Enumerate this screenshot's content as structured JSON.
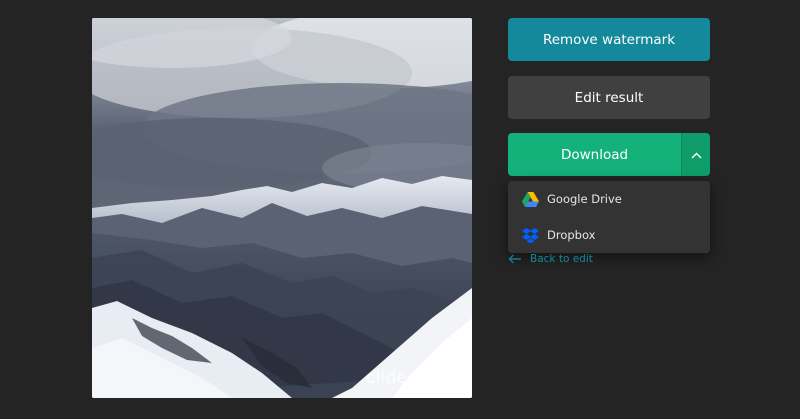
{
  "preview": {
    "watermark_text": "clideo.com"
  },
  "actions": {
    "remove_watermark_label": "Remove watermark",
    "edit_result_label": "Edit result",
    "download_label": "Download",
    "download_toggle_icon": "chevron-up-icon"
  },
  "download_menu": {
    "items": [
      {
        "label": "Google Drive",
        "icon": "google-drive-icon"
      },
      {
        "label": "Dropbox",
        "icon": "dropbox-icon"
      }
    ]
  },
  "back_link": {
    "label": "Back to edit",
    "icon": "arrow-left-icon"
  },
  "colors": {
    "background": "#242424",
    "remove_button": "#14899b",
    "edit_button": "#404040",
    "download_button": "#14b17b",
    "dropdown_bg": "#333333",
    "link": "#14899b"
  }
}
